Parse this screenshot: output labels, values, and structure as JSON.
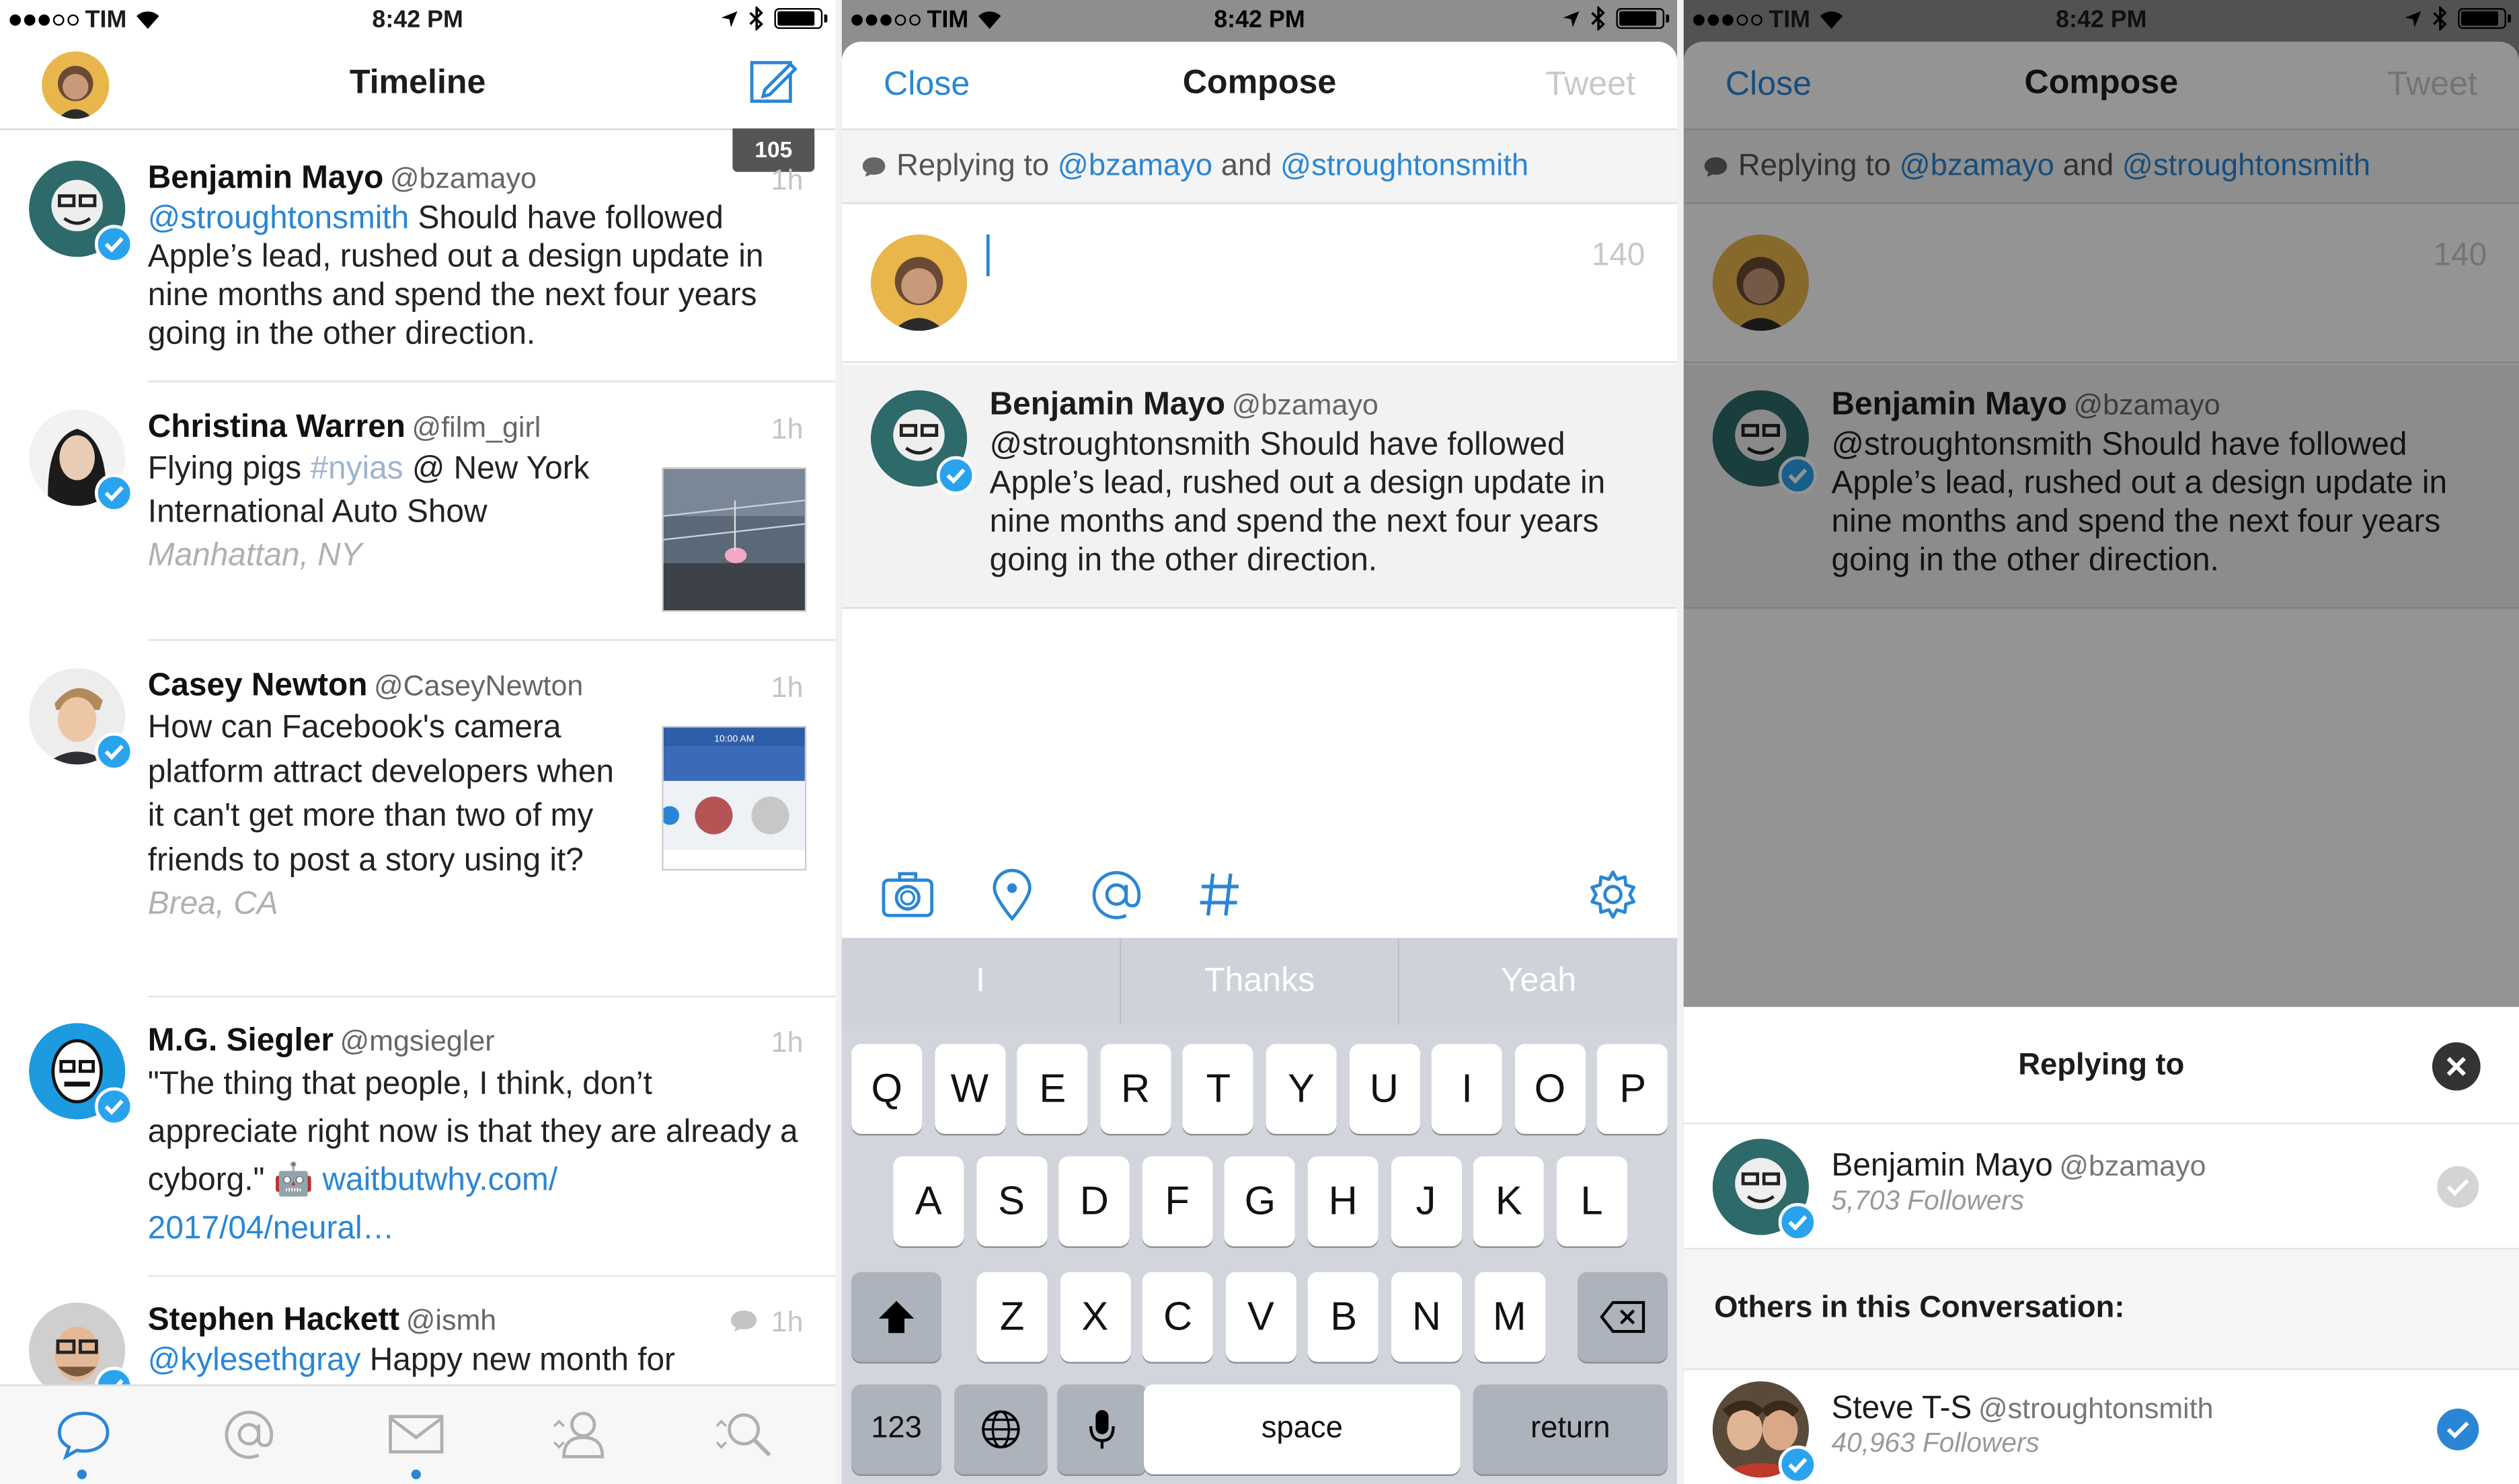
{
  "status": {
    "carrier": "TIM",
    "time": "8:42 PM"
  },
  "timeline": {
    "title": "Timeline",
    "new_count": "105",
    "tweets": [
      {
        "name": "Benjamin Mayo",
        "handle": "@bzamayo",
        "time": "1h",
        "mention": "@stroughtonsmith",
        "text": " Should have followed Apple’s lead, rushed out a design update in nine months and spend the next four years going in the other direction."
      },
      {
        "name": "Christina Warren",
        "handle": "@film_girl",
        "time": "1h",
        "text_a": "Flying pigs ",
        "hashtag": "#nyias",
        "text_b": " @ New York International Auto Show",
        "place": "Manhattan, NY"
      },
      {
        "name": "Casey Newton",
        "handle": "@CaseyNewton",
        "time": "1h",
        "text": "How can Facebook's camera platform attract developers when it can't get more than two of my friends to post a story using it?",
        "place": "Brea, CA",
        "thumb_time": "10:00 AM"
      },
      {
        "name": "M.G. Siegler",
        "handle": "@mgsiegler",
        "time": "1h",
        "text": "\"The thing that people, I think, don’t appreciate right now is that they are already a cyborg.\" 🤖 ",
        "link_a": "waitbutwhy.com/",
        "link_b": "2017/04/neural…"
      },
      {
        "name": "Stephen Hackett",
        "handle": "@ismh",
        "time": "1h",
        "mention": "@kylesethgray",
        "text": " Happy new month for"
      }
    ],
    "tabs": [
      "timeline-tab",
      "mentions-tab",
      "messages-tab",
      "profile-tab",
      "search-tab"
    ]
  },
  "compose": {
    "close": "Close",
    "title": "Compose",
    "tweet": "Tweet",
    "replying_prefix": "Replying to ",
    "reply_user_a": "@bzamayo",
    "reply_and": " and ",
    "reply_user_b": "@stroughtonsmith",
    "counter": "140",
    "quoted": {
      "name": "Benjamin Mayo",
      "handle": "@bzamayo",
      "text": "@stroughtonsmith Should have followed Apple’s lead, rushed out a design update in nine months and spend the next four years going in the other direction."
    },
    "suggestions": [
      "I",
      "Thanks",
      "Yeah"
    ],
    "keys_row1": [
      "Q",
      "W",
      "E",
      "R",
      "T",
      "Y",
      "U",
      "I",
      "O",
      "P"
    ],
    "keys_row2": [
      "A",
      "S",
      "D",
      "F",
      "G",
      "H",
      "J",
      "K",
      "L"
    ],
    "keys_row3": [
      "Z",
      "X",
      "C",
      "V",
      "B",
      "N",
      "M"
    ],
    "key_123": "123",
    "key_space": "space",
    "key_return": "return"
  },
  "sheet": {
    "title": "Replying to",
    "primary": {
      "name": "Benjamin Mayo",
      "handle": "@bzamayo",
      "followers": "5,703 Followers"
    },
    "others_label": "Others in this Conversation:",
    "other": {
      "name": "Steve T-S",
      "handle": "@stroughtonsmith",
      "followers": "40,963 Followers"
    }
  },
  "colors": {
    "accent": "#2a86d4",
    "verified": "#2aa3ef",
    "keyboard": "#d2d5db"
  }
}
